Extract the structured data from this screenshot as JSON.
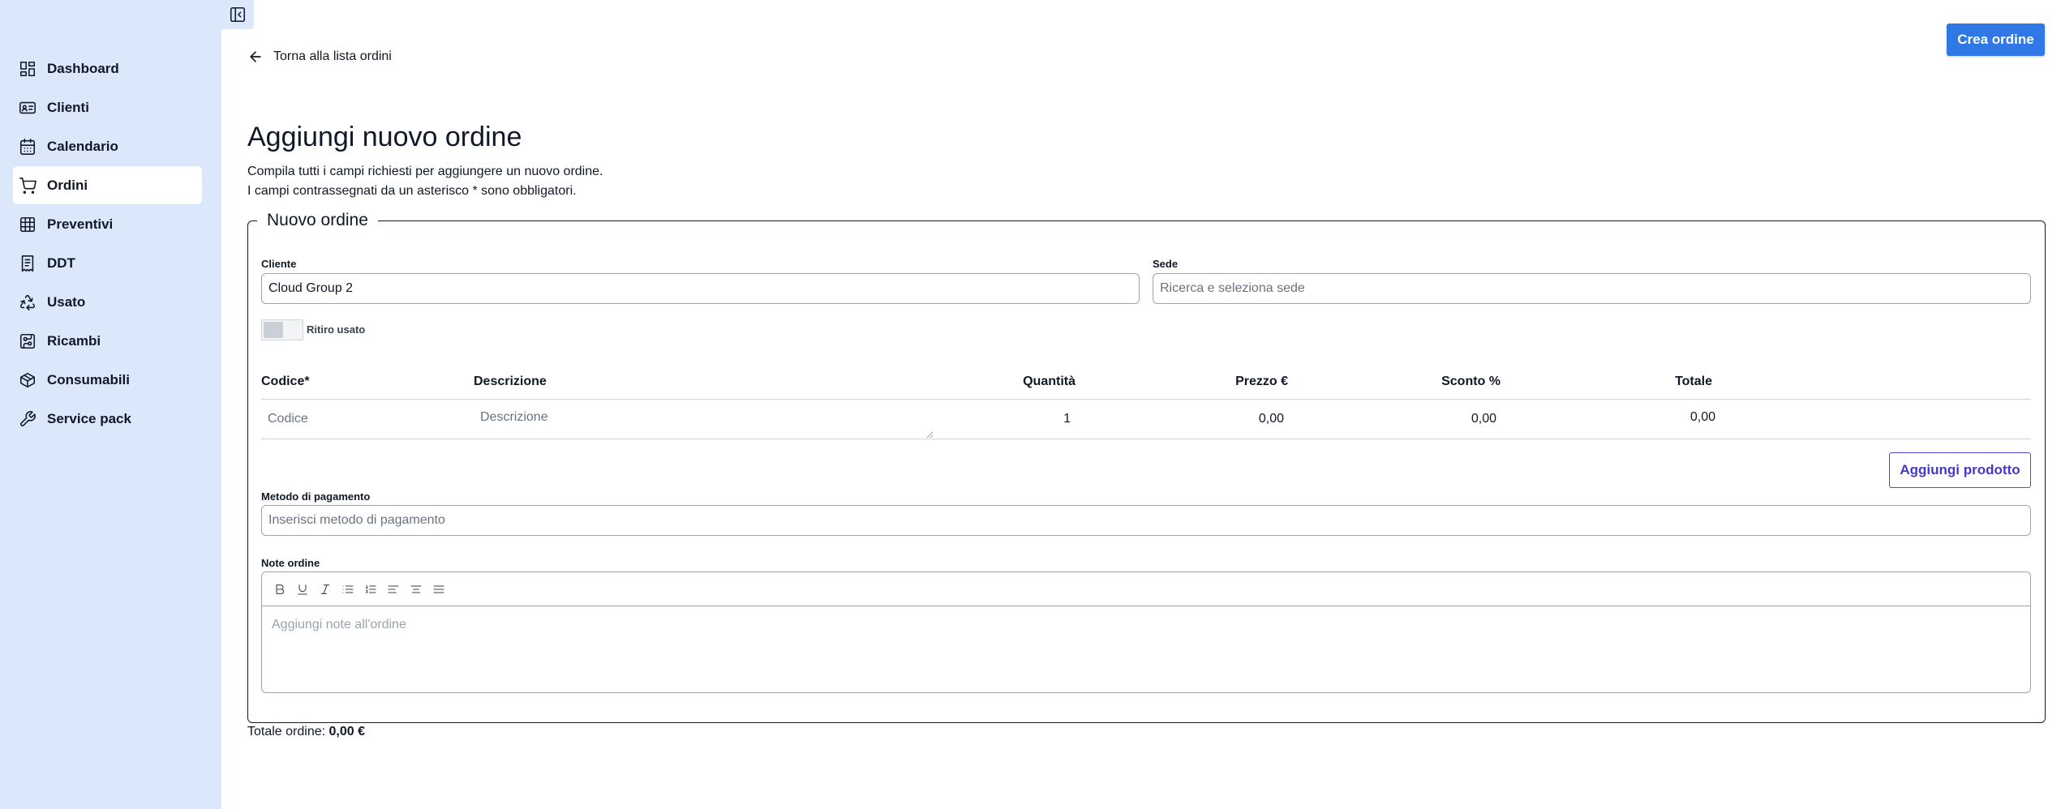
{
  "sidebar": {
    "items": [
      {
        "label": "Dashboard",
        "icon": "dashboard-icon",
        "active": false
      },
      {
        "label": "Clienti",
        "icon": "id-card-icon",
        "active": false
      },
      {
        "label": "Calendario",
        "icon": "calendar-icon",
        "active": false
      },
      {
        "label": "Ordini",
        "icon": "cart-icon",
        "active": true
      },
      {
        "label": "Preventivi",
        "icon": "table-icon",
        "active": false
      },
      {
        "label": "DDT",
        "icon": "receipt-icon",
        "active": false
      },
      {
        "label": "Usato",
        "icon": "recycle-icon",
        "active": false
      },
      {
        "label": "Ricambi",
        "icon": "circuit-board-icon",
        "active": false
      },
      {
        "label": "Consumabili",
        "icon": "package-icon",
        "active": false
      },
      {
        "label": "Service pack",
        "icon": "wrench-icon",
        "active": false
      }
    ],
    "toggle_icon": "sidebar-collapse-icon"
  },
  "header": {
    "back_label": "Torna alla lista ordini",
    "create_button": "Crea ordine"
  },
  "page": {
    "title": "Aggiungi nuovo ordine",
    "subtitle_line1": "Compila tutti i campi richiesti per aggiungere un nuovo ordine.",
    "subtitle_line2": "I campi contrassegnati da un asterisco * sono obbligatori."
  },
  "form": {
    "legend": "Nuovo ordine",
    "cliente": {
      "label": "Cliente",
      "value": "Cloud Group 2"
    },
    "sede": {
      "label": "Sede",
      "placeholder": "Ricerca e seleziona sede"
    },
    "ritiro_usato": {
      "label": "Ritiro usato",
      "checked": false
    },
    "table": {
      "headers": [
        "Codice*",
        "Descrizione",
        "Quantità",
        "Prezzo €",
        "Sconto %",
        "Totale"
      ],
      "rows": [
        {
          "codice_placeholder": "Codice",
          "descrizione_placeholder": "Descrizione",
          "quantita": "1",
          "prezzo": "0,00",
          "sconto": "0,00",
          "totale": "0,00"
        }
      ]
    },
    "add_product_button": "Aggiungi prodotto",
    "metodo_pagamento": {
      "label": "Metodo di pagamento",
      "placeholder": "Inserisci metodo di pagamento"
    },
    "note": {
      "label": "Note ordine",
      "placeholder": "Aggiungi note all'ordine"
    }
  },
  "footer": {
    "total_label": "Totale ordine:",
    "total_value": "0,00 €"
  },
  "colors": {
    "sidebar_bg": "#dbe8fc",
    "primary": "#2f78e6",
    "outline_accent": "#4f46e5"
  }
}
